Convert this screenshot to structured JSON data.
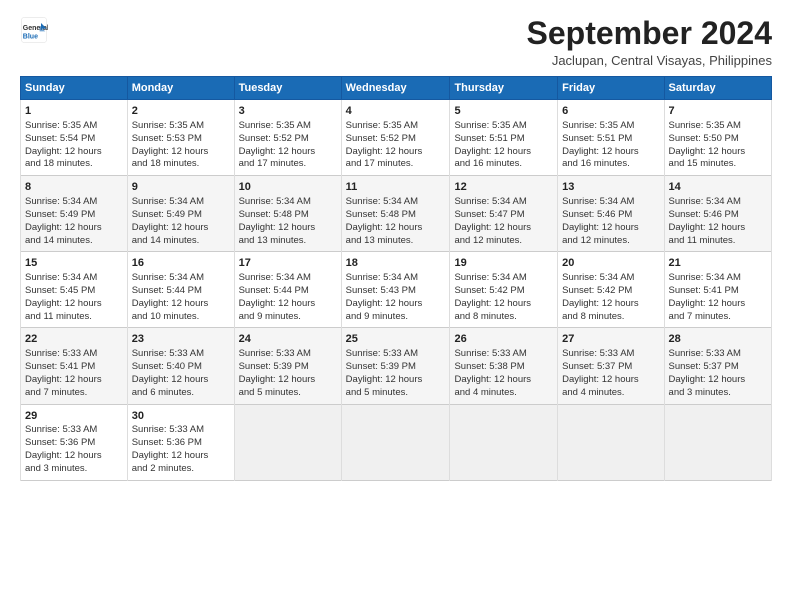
{
  "header": {
    "logo_line1": "General",
    "logo_line2": "Blue",
    "month": "September 2024",
    "location": "Jaclupan, Central Visayas, Philippines"
  },
  "weekdays": [
    "Sunday",
    "Monday",
    "Tuesday",
    "Wednesday",
    "Thursday",
    "Friday",
    "Saturday"
  ],
  "weeks": [
    [
      {
        "day": "1",
        "info": "Sunrise: 5:35 AM\nSunset: 5:54 PM\nDaylight: 12 hours\nand 18 minutes."
      },
      {
        "day": "2",
        "info": "Sunrise: 5:35 AM\nSunset: 5:53 PM\nDaylight: 12 hours\nand 18 minutes."
      },
      {
        "day": "3",
        "info": "Sunrise: 5:35 AM\nSunset: 5:52 PM\nDaylight: 12 hours\nand 17 minutes."
      },
      {
        "day": "4",
        "info": "Sunrise: 5:35 AM\nSunset: 5:52 PM\nDaylight: 12 hours\nand 17 minutes."
      },
      {
        "day": "5",
        "info": "Sunrise: 5:35 AM\nSunset: 5:51 PM\nDaylight: 12 hours\nand 16 minutes."
      },
      {
        "day": "6",
        "info": "Sunrise: 5:35 AM\nSunset: 5:51 PM\nDaylight: 12 hours\nand 16 minutes."
      },
      {
        "day": "7",
        "info": "Sunrise: 5:35 AM\nSunset: 5:50 PM\nDaylight: 12 hours\nand 15 minutes."
      }
    ],
    [
      {
        "day": "8",
        "info": "Sunrise: 5:34 AM\nSunset: 5:49 PM\nDaylight: 12 hours\nand 14 minutes."
      },
      {
        "day": "9",
        "info": "Sunrise: 5:34 AM\nSunset: 5:49 PM\nDaylight: 12 hours\nand 14 minutes."
      },
      {
        "day": "10",
        "info": "Sunrise: 5:34 AM\nSunset: 5:48 PM\nDaylight: 12 hours\nand 13 minutes."
      },
      {
        "day": "11",
        "info": "Sunrise: 5:34 AM\nSunset: 5:48 PM\nDaylight: 12 hours\nand 13 minutes."
      },
      {
        "day": "12",
        "info": "Sunrise: 5:34 AM\nSunset: 5:47 PM\nDaylight: 12 hours\nand 12 minutes."
      },
      {
        "day": "13",
        "info": "Sunrise: 5:34 AM\nSunset: 5:46 PM\nDaylight: 12 hours\nand 12 minutes."
      },
      {
        "day": "14",
        "info": "Sunrise: 5:34 AM\nSunset: 5:46 PM\nDaylight: 12 hours\nand 11 minutes."
      }
    ],
    [
      {
        "day": "15",
        "info": "Sunrise: 5:34 AM\nSunset: 5:45 PM\nDaylight: 12 hours\nand 11 minutes."
      },
      {
        "day": "16",
        "info": "Sunrise: 5:34 AM\nSunset: 5:44 PM\nDaylight: 12 hours\nand 10 minutes."
      },
      {
        "day": "17",
        "info": "Sunrise: 5:34 AM\nSunset: 5:44 PM\nDaylight: 12 hours\nand 9 minutes."
      },
      {
        "day": "18",
        "info": "Sunrise: 5:34 AM\nSunset: 5:43 PM\nDaylight: 12 hours\nand 9 minutes."
      },
      {
        "day": "19",
        "info": "Sunrise: 5:34 AM\nSunset: 5:42 PM\nDaylight: 12 hours\nand 8 minutes."
      },
      {
        "day": "20",
        "info": "Sunrise: 5:34 AM\nSunset: 5:42 PM\nDaylight: 12 hours\nand 8 minutes."
      },
      {
        "day": "21",
        "info": "Sunrise: 5:34 AM\nSunset: 5:41 PM\nDaylight: 12 hours\nand 7 minutes."
      }
    ],
    [
      {
        "day": "22",
        "info": "Sunrise: 5:33 AM\nSunset: 5:41 PM\nDaylight: 12 hours\nand 7 minutes."
      },
      {
        "day": "23",
        "info": "Sunrise: 5:33 AM\nSunset: 5:40 PM\nDaylight: 12 hours\nand 6 minutes."
      },
      {
        "day": "24",
        "info": "Sunrise: 5:33 AM\nSunset: 5:39 PM\nDaylight: 12 hours\nand 5 minutes."
      },
      {
        "day": "25",
        "info": "Sunrise: 5:33 AM\nSunset: 5:39 PM\nDaylight: 12 hours\nand 5 minutes."
      },
      {
        "day": "26",
        "info": "Sunrise: 5:33 AM\nSunset: 5:38 PM\nDaylight: 12 hours\nand 4 minutes."
      },
      {
        "day": "27",
        "info": "Sunrise: 5:33 AM\nSunset: 5:37 PM\nDaylight: 12 hours\nand 4 minutes."
      },
      {
        "day": "28",
        "info": "Sunrise: 5:33 AM\nSunset: 5:37 PM\nDaylight: 12 hours\nand 3 minutes."
      }
    ],
    [
      {
        "day": "29",
        "info": "Sunrise: 5:33 AM\nSunset: 5:36 PM\nDaylight: 12 hours\nand 3 minutes."
      },
      {
        "day": "30",
        "info": "Sunrise: 5:33 AM\nSunset: 5:36 PM\nDaylight: 12 hours\nand 2 minutes."
      },
      {
        "day": "",
        "info": ""
      },
      {
        "day": "",
        "info": ""
      },
      {
        "day": "",
        "info": ""
      },
      {
        "day": "",
        "info": ""
      },
      {
        "day": "",
        "info": ""
      }
    ]
  ]
}
